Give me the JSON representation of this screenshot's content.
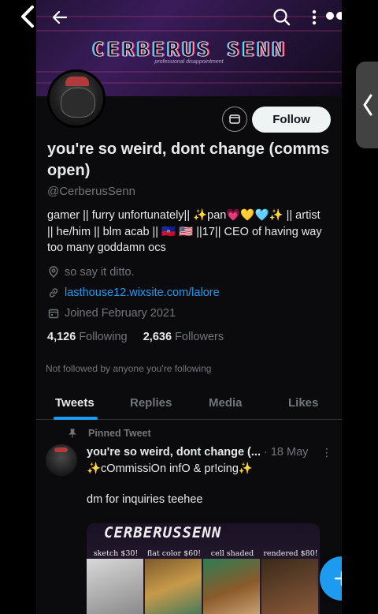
{
  "banner": {
    "title": "CERBERUS SENN",
    "subtitle": "professional disappointment"
  },
  "profile": {
    "display_name": "you're so weird, dont change (comms open)",
    "handle": "@CerberusSenn",
    "bio_lines": [
      "gamer || furry unfortunately|| ✨pan💗💛🩵✨ || artist",
      "|| he/him || blm acab || 🇭🇹 🇺🇸 ||17|| CEO of having way",
      "too many goddamn ocs"
    ],
    "location": "so say it ditto.",
    "website": "lasthouse12.wixsite.com/lalore",
    "joined": "Joined February 2021",
    "following_count": "4,126",
    "following_label": "Following",
    "followers_count": "2,636",
    "followers_label": "Followers",
    "followers_note": "Not followed by anyone you're following"
  },
  "actions": {
    "follow_label": "Follow"
  },
  "tabs": [
    {
      "label": "Tweets"
    },
    {
      "label": "Replies"
    },
    {
      "label": "Media"
    },
    {
      "label": "Likes"
    }
  ],
  "tweet": {
    "pinned_label": "Pinned Tweet",
    "name": "you're so weird, dont change (...",
    "date": "· 18 May",
    "line1": "✨cOmmissiOn infO & pr!cing✨",
    "line2": "dm for inquiries teehee",
    "media_title": "CERBERUSSENN",
    "media_labels": [
      "sketch $30!",
      "flat color $60!",
      "cell shaded $60!",
      "rendered $80!"
    ]
  },
  "icons": {
    "system_back": "chevron-left-icon",
    "back": "arrow-left-icon",
    "search": "search-icon",
    "more": "more-vertical-icon",
    "overflow": "more-horizontal-icon",
    "message": "mail-icon",
    "location": "location-pin-icon",
    "link": "link-icon",
    "calendar": "calendar-icon",
    "pin": "pin-icon",
    "compose": "plus-icon",
    "edge": "chevron-left-icon"
  },
  "colors": {
    "accent": "#1d9bf0",
    "background": "#000000",
    "text": "#e7e9ea",
    "muted": "#71767b"
  }
}
